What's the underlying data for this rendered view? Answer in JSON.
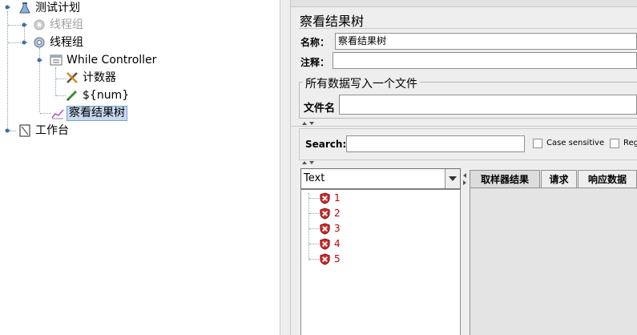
{
  "tree": {
    "items": [
      {
        "label": "测试计划",
        "icon": "flask-icon",
        "state": "normal"
      },
      {
        "label": "线程组",
        "icon": "gear-icon",
        "state": "disabled"
      },
      {
        "label": "线程组",
        "icon": "gear-icon",
        "state": "normal"
      },
      {
        "label": "While Controller",
        "icon": "controller-icon",
        "state": "normal"
      },
      {
        "label": "计数器",
        "icon": "wrench-icon",
        "state": "normal"
      },
      {
        "label": "${num}",
        "icon": "pencil-icon",
        "state": "normal"
      },
      {
        "label": "察看结果树",
        "icon": "chart-icon",
        "state": "selected"
      },
      {
        "label": "工作台",
        "icon": "workbench-icon",
        "state": "normal"
      }
    ]
  },
  "panel": {
    "title": "察看结果树",
    "name_label": "名称：",
    "name_value": "察看结果树",
    "comment_label": "注释：",
    "comment_value": "",
    "file_group_title": "所有数据写入一个文件",
    "filename_label": "文件名",
    "filename_value": ""
  },
  "search": {
    "label": "Search:",
    "value": "",
    "case_sensitive_label": "Case sensitive",
    "regex_label": "Reg"
  },
  "results": {
    "renderer_selected": "Text",
    "items": [
      "1",
      "2",
      "3",
      "4",
      "5"
    ],
    "status_color": "#c00000"
  },
  "tabs": [
    {
      "label": "取样器结果",
      "active": true
    },
    {
      "label": "请求",
      "active": false
    },
    {
      "label": "响应数据",
      "active": false
    }
  ],
  "colors": {
    "selection_bg": "#c8d9ee",
    "panel_bg": "#eeeeee",
    "error_red": "#c00000"
  }
}
